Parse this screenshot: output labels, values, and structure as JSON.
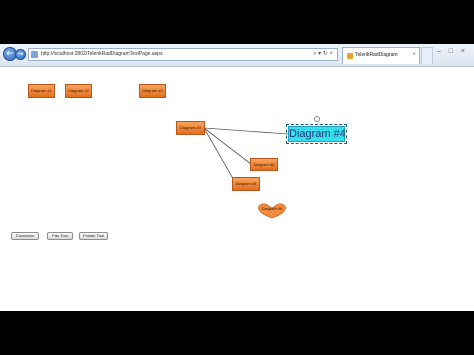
{
  "browser": {
    "address": "http://localhost:2802/TelerikRadDiagramTestPage.aspx",
    "address_tools": "⌕ ▾ ↻ ×",
    "tab_title": "TelerikRadDiagram",
    "tab_close": "×",
    "back_glyph": "←",
    "forward_glyph": "→",
    "window_controls": "– □ ×"
  },
  "diagram": {
    "shapes": [
      {
        "id": "n1",
        "label": "Diagram #1"
      },
      {
        "id": "n2",
        "label": "Diagram #2"
      },
      {
        "id": "n3",
        "label": "Diagram #3"
      },
      {
        "id": "n4",
        "label": "Diagram #4"
      },
      {
        "id": "n5",
        "label": "Diagram #4"
      },
      {
        "id": "n6",
        "label": "Diagram #6"
      },
      {
        "id": "n7",
        "label": "Diagram #5"
      },
      {
        "id": "n8",
        "label": "Diagram #6"
      }
    ],
    "connections": [
      {
        "from": "n5",
        "to": "n4"
      },
      {
        "from": "n5",
        "to": "n6"
      },
      {
        "from": "n5",
        "to": "n7"
      }
    ],
    "colors": {
      "shape_fill": "#f38a3c",
      "selected_fill": "#35e0ee",
      "connector": "#5a5a5a"
    }
  },
  "toolbar": {
    "connector_label": "Connector",
    "pan_label": "Pan Tool",
    "pointer_label": "Pointer Tool"
  }
}
